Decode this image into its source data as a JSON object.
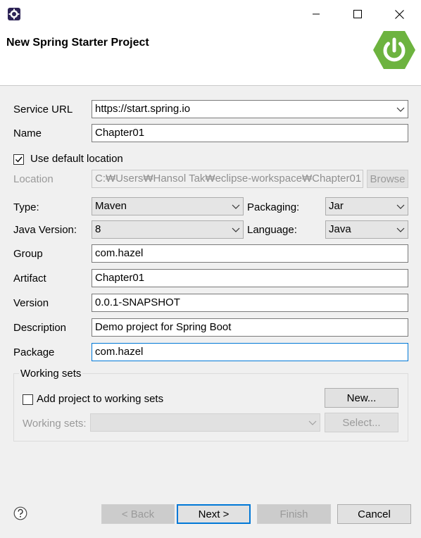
{
  "window": {
    "title": "",
    "minimize_icon": "minimize-icon",
    "maximize_icon": "maximize-icon",
    "close_icon": "close-icon"
  },
  "header": {
    "title": "New Spring Starter Project",
    "logo_icon": "spring-power-icon",
    "logo_color": "#6db33f"
  },
  "form": {
    "service_url": {
      "label": "Service URL",
      "value": "https://start.spring.io"
    },
    "name": {
      "label": "Name",
      "value": "Chapter01"
    },
    "use_default_location": {
      "label": "Use default location",
      "checked": true
    },
    "location": {
      "label": "Location",
      "value": "C:₩Users₩Hansol Tak₩eclipse-workspace₩Chapter01",
      "browse_label": "Browse"
    },
    "type": {
      "label": "Type:",
      "value": "Maven"
    },
    "packaging": {
      "label": "Packaging:",
      "value": "Jar"
    },
    "java_version": {
      "label": "Java Version:",
      "value": "8"
    },
    "language": {
      "label": "Language:",
      "value": "Java"
    },
    "group": {
      "label": "Group",
      "value": "com.hazel"
    },
    "artifact": {
      "label": "Artifact",
      "value": "Chapter01"
    },
    "version": {
      "label": "Version",
      "value": "0.0.1-SNAPSHOT"
    },
    "description": {
      "label": "Description",
      "value": "Demo project for Spring Boot"
    },
    "package": {
      "label": "Package",
      "value": "com.hazel"
    }
  },
  "working_sets": {
    "group_label": "Working sets",
    "add_label": "Add project to working sets",
    "add_checked": false,
    "new_label": "New...",
    "sets_label": "Working sets:",
    "sets_value": "",
    "select_label": "Select..."
  },
  "footer": {
    "help_icon": "help-icon",
    "back_label": "< Back",
    "next_label": "Next >",
    "finish_label": "Finish",
    "cancel_label": "Cancel"
  }
}
